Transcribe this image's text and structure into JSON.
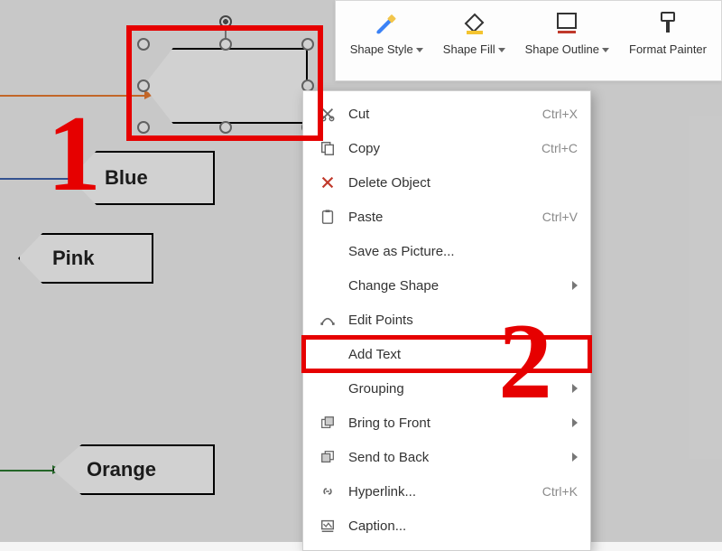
{
  "toolbar": {
    "shape_style": "Shape Style",
    "shape_fill": "Shape Fill",
    "shape_outline": "Shape Outline",
    "format_painter": "Format Painter"
  },
  "shapes": {
    "blue_label": "Blue",
    "pink_label": "Pink",
    "orange_label": "Orange"
  },
  "annotations": {
    "step1": "1",
    "step2": "2"
  },
  "context_menu": {
    "cut": {
      "label": "Cut",
      "shortcut": "Ctrl+X"
    },
    "copy": {
      "label": "Copy",
      "shortcut": "Ctrl+C"
    },
    "delete_object": {
      "label": "Delete Object"
    },
    "paste": {
      "label": "Paste",
      "shortcut": "Ctrl+V"
    },
    "save_picture": {
      "label": "Save as Picture..."
    },
    "change_shape": {
      "label": "Change Shape"
    },
    "edit_points": {
      "label": "Edit Points"
    },
    "add_text": {
      "label": "Add Text"
    },
    "grouping": {
      "label": "Grouping"
    },
    "bring_front": {
      "label": "Bring to Front"
    },
    "send_back": {
      "label": "Send to Back"
    },
    "hyperlink": {
      "label": "Hyperlink...",
      "shortcut": "Ctrl+K"
    },
    "caption": {
      "label": "Caption..."
    }
  }
}
